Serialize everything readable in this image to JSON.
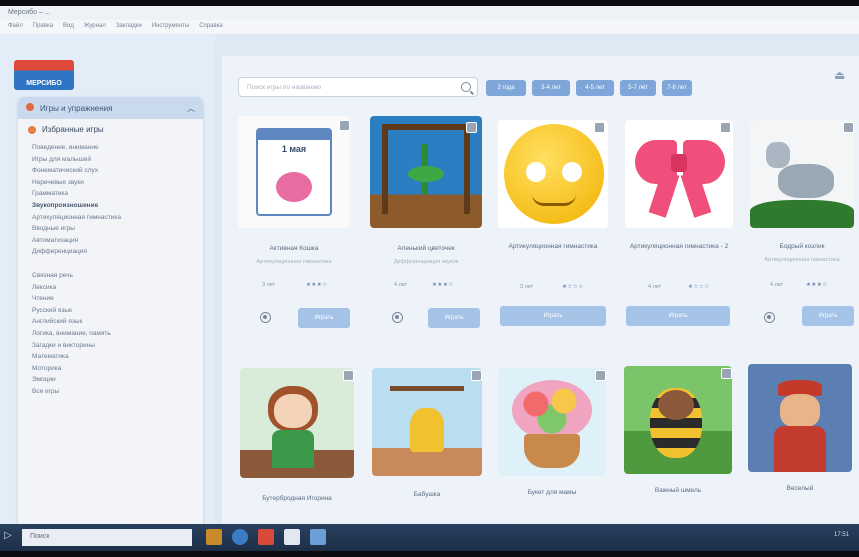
{
  "window": {
    "title": "Мерсибо – ...",
    "menu": [
      "Файл",
      "Правка",
      "Вид",
      "Журнал",
      "Закладки",
      "Инструменты",
      "Справка"
    ]
  },
  "brand": {
    "logo_text": "МЕРСИБО"
  },
  "sidebar": {
    "header": "Игры и упражнения",
    "favorites": "Избранные игры",
    "groups": [
      [
        {
          "label": "Поведение, внимание",
          "bold": false
        },
        {
          "label": "Игры для малышей",
          "bold": false
        },
        {
          "label": "Фонематический слух",
          "bold": false
        },
        {
          "label": "Неречевые звуки",
          "bold": false
        },
        {
          "label": "Грамматика",
          "bold": false
        },
        {
          "label": "Звукопроизношение",
          "bold": true
        },
        {
          "label": "Артикуляционная гимнастика",
          "bold": false
        },
        {
          "label": "Вводные игры",
          "bold": false
        },
        {
          "label": "Автоматизация",
          "bold": false
        },
        {
          "label": "Дифференциация",
          "bold": false
        }
      ],
      [
        {
          "label": "Связная речь",
          "bold": false
        },
        {
          "label": "Лексика",
          "bold": false
        },
        {
          "label": "Чтение",
          "bold": false
        },
        {
          "label": "Русский язык",
          "bold": false
        },
        {
          "label": "Английский язык",
          "bold": false
        },
        {
          "label": "Логика, внимание, память",
          "bold": false
        },
        {
          "label": "Загадки и викторины",
          "bold": false
        },
        {
          "label": "Математика",
          "bold": false
        },
        {
          "label": "Моторика",
          "bold": false
        },
        {
          "label": "Эмоции",
          "bold": false
        },
        {
          "label": "Все игры",
          "bold": false
        }
      ]
    ]
  },
  "search": {
    "placeholder": "Поиск игры по названию"
  },
  "age_filters": [
    "2 года",
    "3-4 лет",
    "4-5 лет",
    "5-7 лет",
    "7-8 лет"
  ],
  "cards_row1": [
    {
      "title": "Активная Кошка",
      "sub": "Артикуляционная гимнастика",
      "age": "3 лет",
      "rating": "★★★☆",
      "gear": true,
      "play": "Играть"
    },
    {
      "title": "Аленький цветочек",
      "sub": "Дифференциация звуков",
      "age": "4 лет",
      "rating": "★★★☆",
      "gear": true,
      "play": "Играть"
    },
    {
      "title": "Артикуляционная гимнастика",
      "sub": "",
      "age": "3 лет",
      "rating": "★☆☆☆",
      "gear": false,
      "play": "Играть"
    },
    {
      "title": "Артикуляционная гимнастика - 2",
      "sub": "",
      "age": "4 лет",
      "rating": "★☆☆☆",
      "gear": false,
      "play": "Играть"
    },
    {
      "title": "Бодрый козлик",
      "sub": "Артикуляционная гимнастика",
      "age": "4 лет",
      "rating": "★★★☆",
      "gear": true,
      "play": "Играть"
    }
  ],
  "cards_row2": [
    {
      "title": "Бутербродная Игорина",
      "sub": ""
    },
    {
      "title": "Бабушка",
      "sub": ""
    },
    {
      "title": "Букет для мамы",
      "sub": ""
    },
    {
      "title": "Важный шмель",
      "sub": ""
    },
    {
      "title": "Веселый",
      "sub": ""
    }
  ],
  "calendar": {
    "date": "1 мая"
  },
  "taskbar": {
    "search_text": "Поиск",
    "clock": "17:51"
  }
}
